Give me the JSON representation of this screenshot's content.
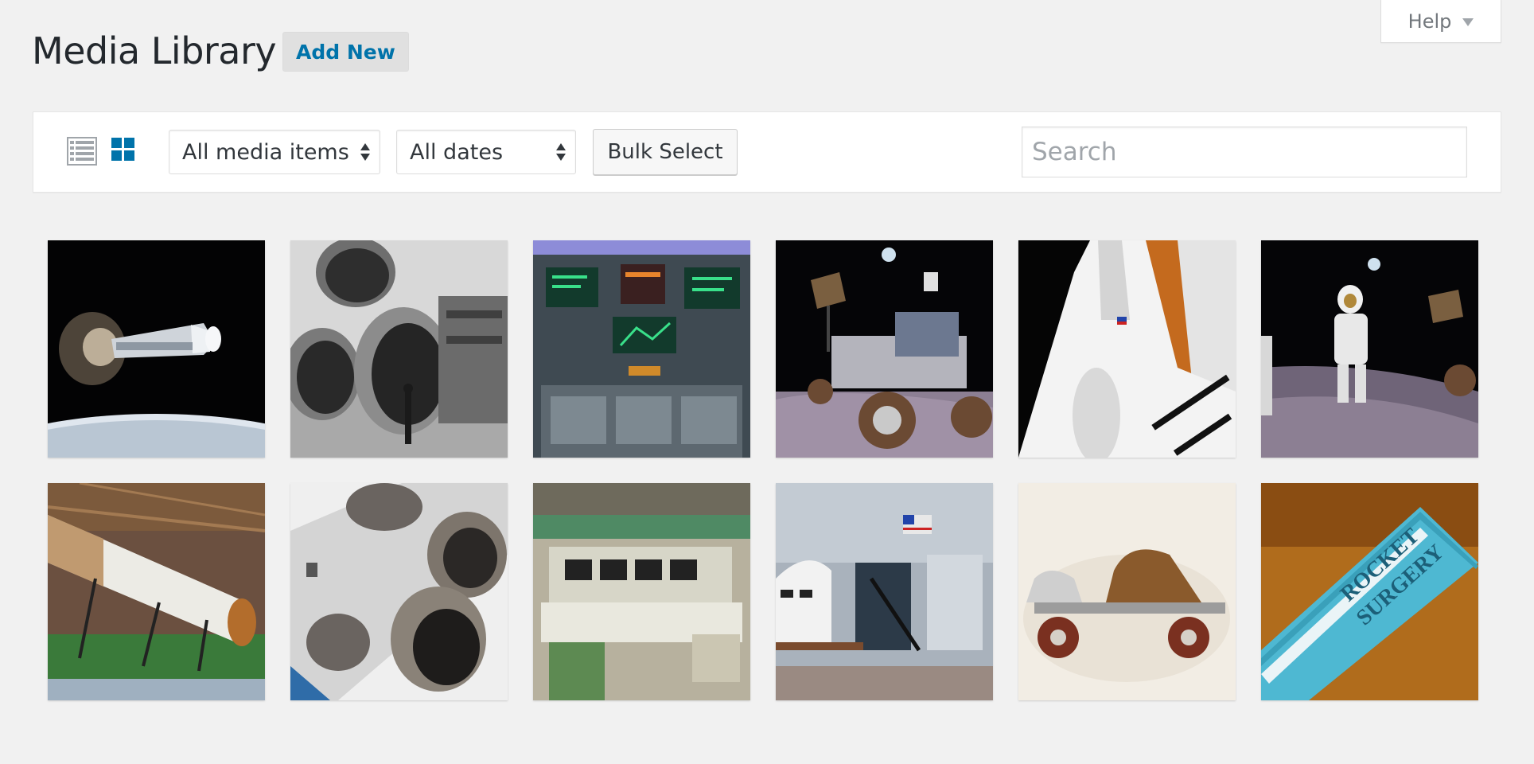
{
  "header": {
    "title": "Media Library",
    "add_new_label": "Add New",
    "help_label": "Help"
  },
  "toolbar": {
    "views": [
      {
        "name": "list-view",
        "icon": "list-icon",
        "active": false
      },
      {
        "name": "grid-view",
        "icon": "grid-icon",
        "active": true
      }
    ],
    "media_filter": {
      "selected": "All media items"
    },
    "date_filter": {
      "selected": "All dates"
    },
    "bulk_select_label": "Bulk Select",
    "search_placeholder": "Search",
    "search_value": ""
  },
  "colors": {
    "accent": "#0073aa",
    "background": "#f1f1f1",
    "active_icon": "#0073aa",
    "inactive_icon": "#a0a5aa"
  },
  "media_items": [
    {
      "id": "rocket-space",
      "row": 0,
      "col": 0
    },
    {
      "id": "saturn-engines-bw",
      "row": 0,
      "col": 1
    },
    {
      "id": "cockpit-panel",
      "row": 0,
      "col": 2
    },
    {
      "id": "lunar-rover",
      "row": 0,
      "col": 3
    },
    {
      "id": "shuttle-endeavour",
      "row": 0,
      "col": 4
    },
    {
      "id": "astronauts-moon",
      "row": 0,
      "col": 5
    },
    {
      "id": "saturn-v-stage",
      "row": 1,
      "col": 0
    },
    {
      "id": "rocket-nozzles",
      "row": 1,
      "col": 1
    },
    {
      "id": "mission-control",
      "row": 1,
      "col": 2
    },
    {
      "id": "space-center-hall",
      "row": 1,
      "col": 3
    },
    {
      "id": "roller-skate",
      "row": 1,
      "col": 4
    },
    {
      "id": "rocket-surgery-book",
      "row": 1,
      "col": 5
    }
  ]
}
